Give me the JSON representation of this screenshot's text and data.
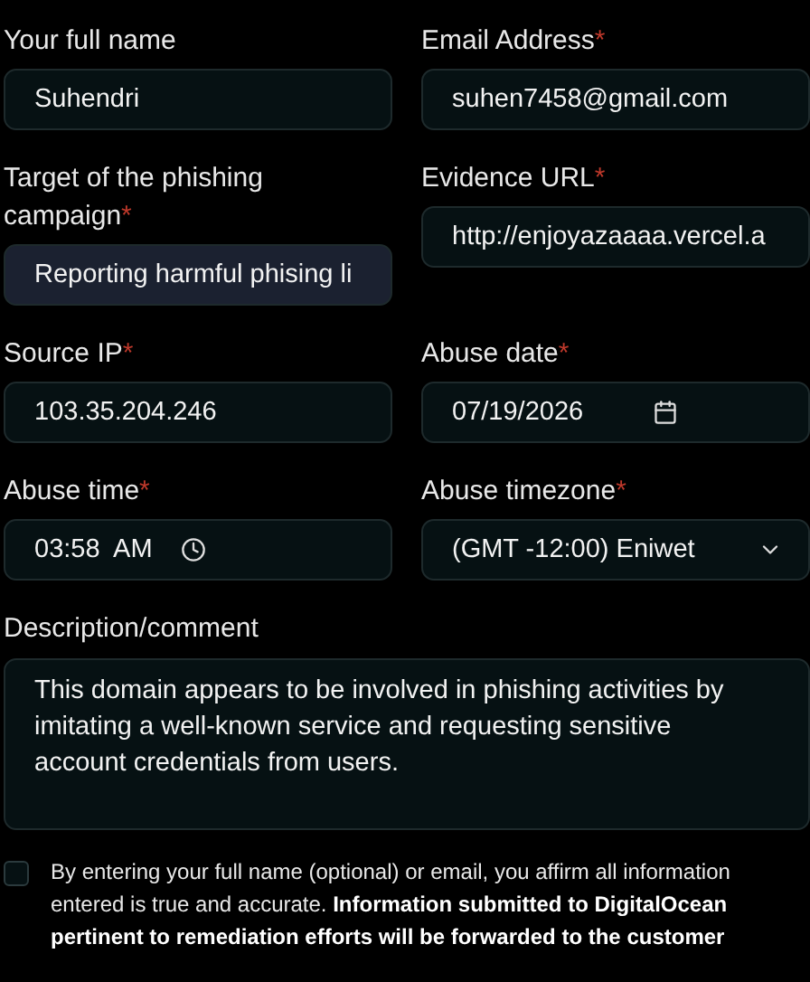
{
  "fields": [
    {
      "label": "Your full name",
      "kind": "text",
      "value": "Suhendri",
      "highlighted": false
    },
    {
      "label": "Email Address",
      "required_mark": "*",
      "kind": "text",
      "value": "suhen7458@gmail.com",
      "highlighted": false
    },
    {
      "label": "Target of the phishing campaign",
      "required_mark": "*",
      "kind": "text",
      "value": "Reporting harmful phising li",
      "highlighted": true
    },
    {
      "label": "Evidence URL",
      "required_mark": "*",
      "kind": "text",
      "value": "http://enjoyazaaaa.vercel.a",
      "highlighted": false
    },
    {
      "label": "Source IP",
      "required_mark": "*",
      "kind": "text",
      "value": "103.35.204.246",
      "highlighted": false
    },
    {
      "label": "Abuse date",
      "required_mark": "*",
      "kind": "date",
      "value": "07/19/2026",
      "highlighted": false
    },
    {
      "label": "Abuse time",
      "required_mark": "*",
      "kind": "time",
      "value": "03:58  AM",
      "highlighted": false
    },
    {
      "label": "Abuse timezone",
      "required_mark": "*",
      "kind": "select",
      "value": "(GMT -12:00) Eniwet",
      "highlighted": false
    }
  ],
  "description": {
    "label": "Description/comment",
    "value": "This domain appears to be involved in phishing activities by imitating a well-known service and requesting sensitive account credentials from users."
  },
  "affirmation": {
    "checked": false,
    "text": "By entering your full name (optional) or email, you affirm all information entered is true and accurate. **Information submitted to DigitalOcean pertinent to remediation efforts will be forwarded to the customer**"
  }
}
